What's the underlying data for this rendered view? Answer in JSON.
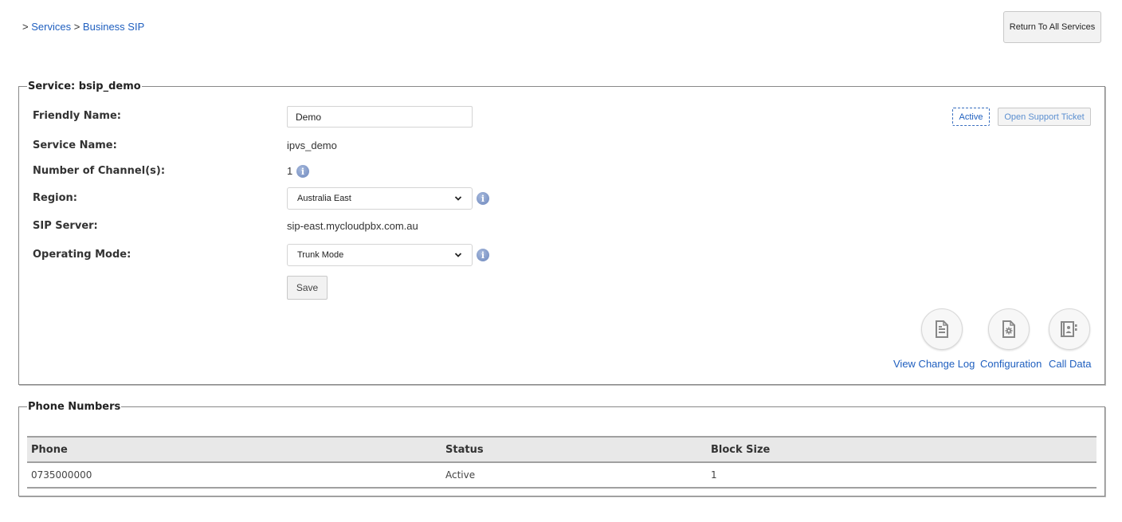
{
  "breadcrumb": {
    "separator": ">",
    "items": [
      "Services",
      "Business SIP"
    ]
  },
  "header": {
    "return_button": "Return To All Services"
  },
  "service": {
    "legend": "Service: bsip_demo",
    "status_badge": "Active",
    "support_button": "Open Support Ticket",
    "fields": {
      "friendly_name": {
        "label": "Friendly Name:",
        "value": "Demo"
      },
      "service_name": {
        "label": "Service Name:",
        "value": "ipvs_demo"
      },
      "channels": {
        "label": "Number of Channel(s):",
        "value": "1"
      },
      "region": {
        "label": "Region:",
        "value": "Australia East"
      },
      "sip_server": {
        "label": "SIP Server:",
        "value": "sip-east.mycloudpbx.com.au"
      },
      "operating_mode": {
        "label": "Operating Mode:",
        "value": "Trunk Mode"
      }
    },
    "save_button": "Save",
    "actions": [
      {
        "label": "View Change Log",
        "icon": "document-icon"
      },
      {
        "label": "Configuration",
        "icon": "config-file-icon"
      },
      {
        "label": "Call Data",
        "icon": "contact-book-icon"
      }
    ]
  },
  "phone_numbers": {
    "legend": "Phone Numbers",
    "columns": [
      "Phone",
      "Status",
      "Block Size"
    ],
    "rows": [
      [
        "0735000000",
        "Active",
        "1"
      ]
    ]
  },
  "colors": {
    "link": "#1f5fbf",
    "info_icon": "#6d87bd",
    "table_header_bg": "#e8e8e8"
  }
}
